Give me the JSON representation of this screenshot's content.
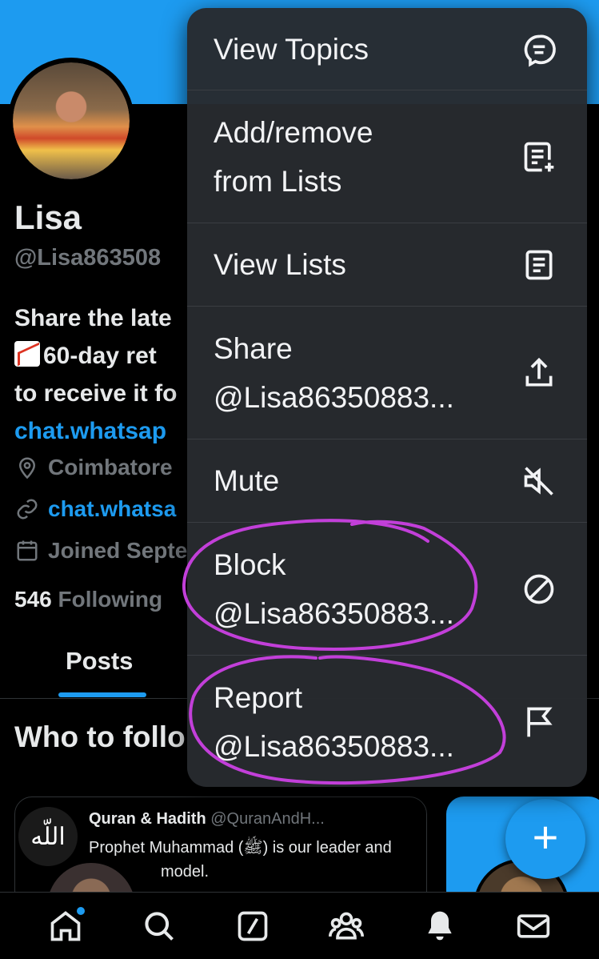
{
  "profile": {
    "name": "Lisa",
    "handle": "@Lisa863508",
    "bio_line1": "Share the late",
    "bio_line2": "60-day ret",
    "bio_line3": "to receive it fo",
    "bio_link": "chat.whatsap",
    "location": "Coimbatore",
    "website": "chat.whatsa",
    "joined": "Joined Septe",
    "following_count": "546",
    "following_label": "Following"
  },
  "tabs": {
    "posts": "Posts"
  },
  "who_to_follow": "Who to follo",
  "recommendation": {
    "name": "Quran & Hadith",
    "handle": "@QuranAndH...",
    "text_line1": "Prophet Muhammad (ﷺ) is our leader and",
    "text_line2": "model.",
    "avatar_text": "اللّه"
  },
  "menu": {
    "items": [
      {
        "label_lines": [
          "View Topics"
        ],
        "icon": "topics-icon"
      },
      {
        "label_lines": [
          "Add/remove",
          "from Lists"
        ],
        "icon": "list-add-icon"
      },
      {
        "label_lines": [
          "View Lists"
        ],
        "icon": "list-icon"
      },
      {
        "label_lines": [
          "Share",
          "@Lisa86350883..."
        ],
        "icon": "share-icon"
      },
      {
        "label_lines": [
          "Mute"
        ],
        "icon": "mute-icon"
      },
      {
        "label_lines": [
          "Block",
          "@Lisa86350883..."
        ],
        "icon": "block-icon"
      },
      {
        "label_lines": [
          "Report",
          "@Lisa86350883..."
        ],
        "icon": "flag-icon"
      }
    ]
  },
  "fab": {
    "label": "+"
  },
  "bottom_nav": [
    "home-icon",
    "search-icon",
    "grok-icon",
    "communities-icon",
    "notifications-icon",
    "messages-icon"
  ],
  "colors": {
    "accent": "#1d9bf0",
    "annotation": "#c23fd9",
    "menu_bg": "#272a2e"
  }
}
